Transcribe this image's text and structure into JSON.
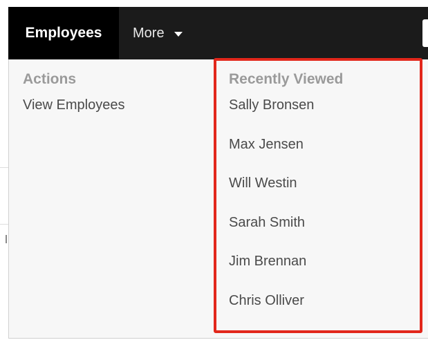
{
  "navbar": {
    "active_tab": "Employees",
    "more_tab": "More",
    "more_icon": "caret-down-icon"
  },
  "dropdown": {
    "actions": {
      "heading": "Actions",
      "items": [
        {
          "label": "View Employees"
        }
      ]
    },
    "recently_viewed": {
      "heading": "Recently Viewed",
      "items": [
        {
          "label": "Sally Bronsen"
        },
        {
          "label": "Max Jensen"
        },
        {
          "label": "Will Westin"
        },
        {
          "label": "Sarah Smith"
        },
        {
          "label": "Jim Brennan"
        },
        {
          "label": "Chris Olliver"
        }
      ]
    }
  },
  "colors": {
    "navbar_bg": "#1b1b1b",
    "active_tab_bg": "#000000",
    "dropdown_bg": "#f7f7f7",
    "highlight_border": "#e2271b",
    "heading_text": "#9a9a9a",
    "item_text": "#4a4a4a"
  }
}
